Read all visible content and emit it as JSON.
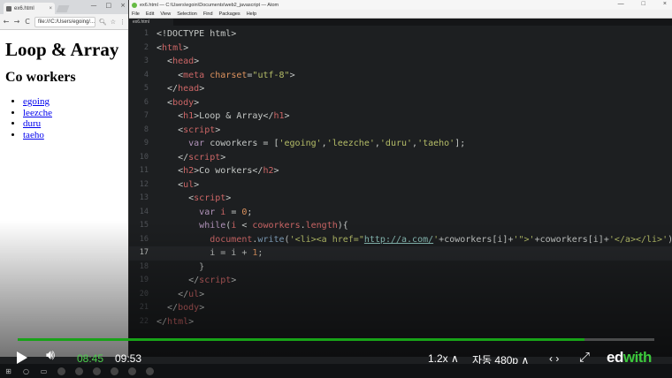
{
  "browser": {
    "tab_title": "ex6.html",
    "tab_close": "×",
    "window_buttons": [
      "—",
      "□",
      "×"
    ],
    "nav": {
      "back": "←",
      "forward": "→",
      "reload": "C"
    },
    "url": "file:///C:/Users/egoing/...",
    "page": {
      "heading": "Loop & Array",
      "subheading": "Co workers",
      "links": [
        "egoing",
        "leezche",
        "duru",
        "taeho"
      ]
    }
  },
  "editor": {
    "title": "ex6.html — C:\\Users\\egoin\\Documents\\web2_javascript — Atom",
    "window_buttons": [
      "—",
      "□",
      "×"
    ],
    "menu": [
      "File",
      "Edit",
      "View",
      "Selection",
      "Find",
      "Packages",
      "Help"
    ],
    "active_tab": "ex6.html",
    "current_line": 17,
    "line_numbers": [
      "1",
      "2",
      "3",
      "4",
      "5",
      "6",
      "7",
      "8",
      "9",
      "10",
      "11",
      "12",
      "13",
      "14",
      "15",
      "16",
      "17",
      "18",
      "19",
      "20",
      "21",
      "22"
    ]
  },
  "player": {
    "progress_fraction": 0.89,
    "current_time": "08:45",
    "total_time": "09:53",
    "speed": "1.2x ∧",
    "quality": "자동 480p ∧",
    "prev_next": "‹ ›",
    "brand_ed": "ed",
    "brand_with": "with",
    "colors": {
      "progress": "#18a318",
      "time": "#4ccf4c",
      "brand": "#3cc83c"
    }
  },
  "icons": {
    "play": "play-icon",
    "volume": "volume-icon",
    "fullscreen": "fullscreen-icon"
  }
}
